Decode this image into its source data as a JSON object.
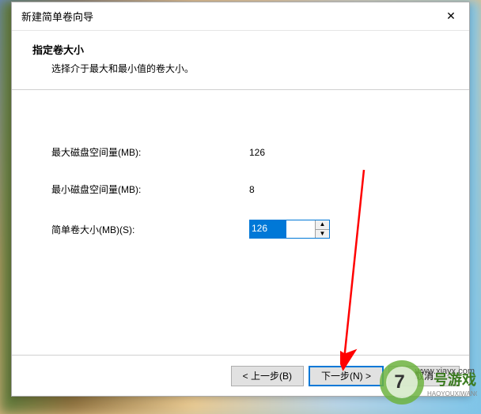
{
  "titlebar": {
    "title": "新建简单卷向导"
  },
  "header": {
    "title": "指定卷大小",
    "subtitle": "选择介于最大和最小值的卷大小。"
  },
  "fields": {
    "max_label": "最大磁盘空间量(MB):",
    "max_value": "126",
    "min_label": "最小磁盘空间量(MB):",
    "min_value": "8",
    "size_label": "简单卷大小(MB)(S):",
    "size_value": "126"
  },
  "buttons": {
    "back": "< 上一步(B)",
    "next": "下一步(N) >",
    "cancel": "取消"
  },
  "watermark": {
    "url": "www.xiayx.com",
    "brand_main": "号游戏",
    "brand_sub": "HAOYOUXIWANG"
  }
}
